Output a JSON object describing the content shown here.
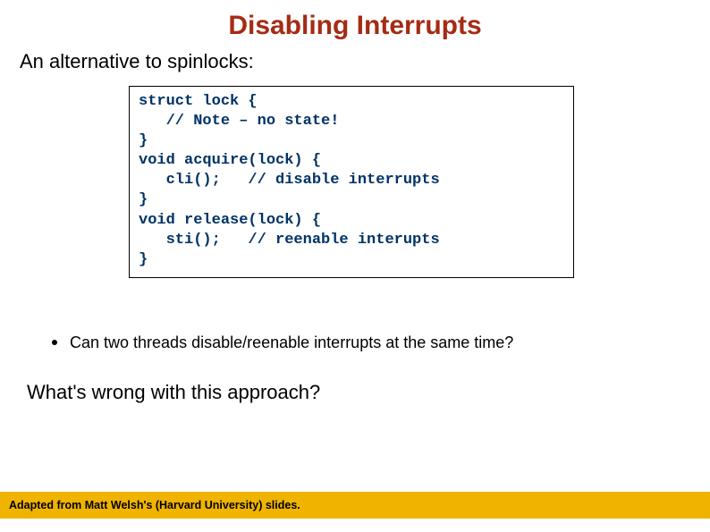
{
  "title": "Disabling Interrupts",
  "subtitle": "An alternative to spinlocks:",
  "code": "struct lock {\n   // Note – no state!\n}\nvoid acquire(lock) {\n   cli();   // disable interrupts\n}\nvoid release(lock) {\n   sti();   // reenable interupts\n}",
  "bullet": "Can two threads disable/reenable interrupts at the same time?",
  "question": "What's wrong with this approach?",
  "footer": "Adapted from Matt Welsh's (Harvard University) slides."
}
